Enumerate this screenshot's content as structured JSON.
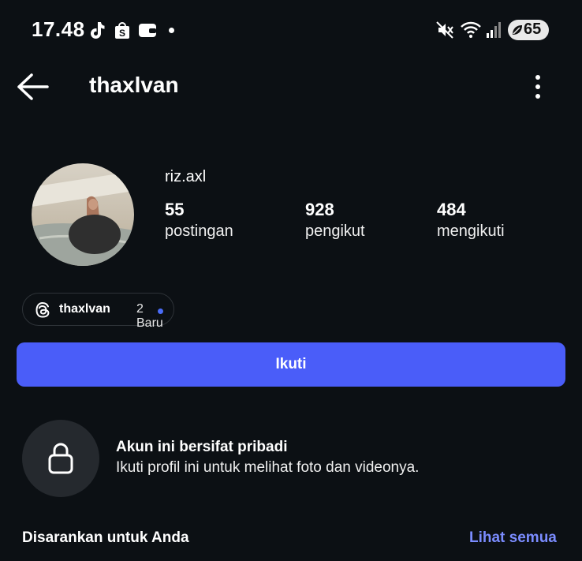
{
  "status_bar": {
    "time": "17.48",
    "icons": [
      "tiktok-icon",
      "shopee-icon",
      "wallet-icon",
      "notification-dot",
      "mute-icon",
      "wifi-icon",
      "signal-icon"
    ],
    "battery": "65"
  },
  "header": {
    "username": "thaxlvan",
    "back_icon": "arrow-left-icon",
    "menu_icon": "more-vertical-icon"
  },
  "profile": {
    "display_name": "riz.axl",
    "stats": [
      {
        "value": "55",
        "label": "postingan"
      },
      {
        "value": "928",
        "label": "pengikut"
      },
      {
        "value": "484",
        "label": "mengikuti"
      }
    ]
  },
  "threads_badge": {
    "icon": "threads-icon",
    "username": "thaxlvan",
    "new_label": "2 Baru"
  },
  "follow_button": {
    "label": "Ikuti",
    "color": "#4a5df9"
  },
  "private_account": {
    "icon": "lock-icon",
    "title": "Akun ini bersifat pribadi",
    "subtitle": "Ikuti profil ini untuk melihat foto dan videonya."
  },
  "suggestions": {
    "title": "Disarankan untuk Anda",
    "see_all": "Lihat semua",
    "link_color": "#7b8cff"
  },
  "colors": {
    "background": "#0c1014",
    "text": "#f5f5f5",
    "accent": "#4a5df9"
  }
}
